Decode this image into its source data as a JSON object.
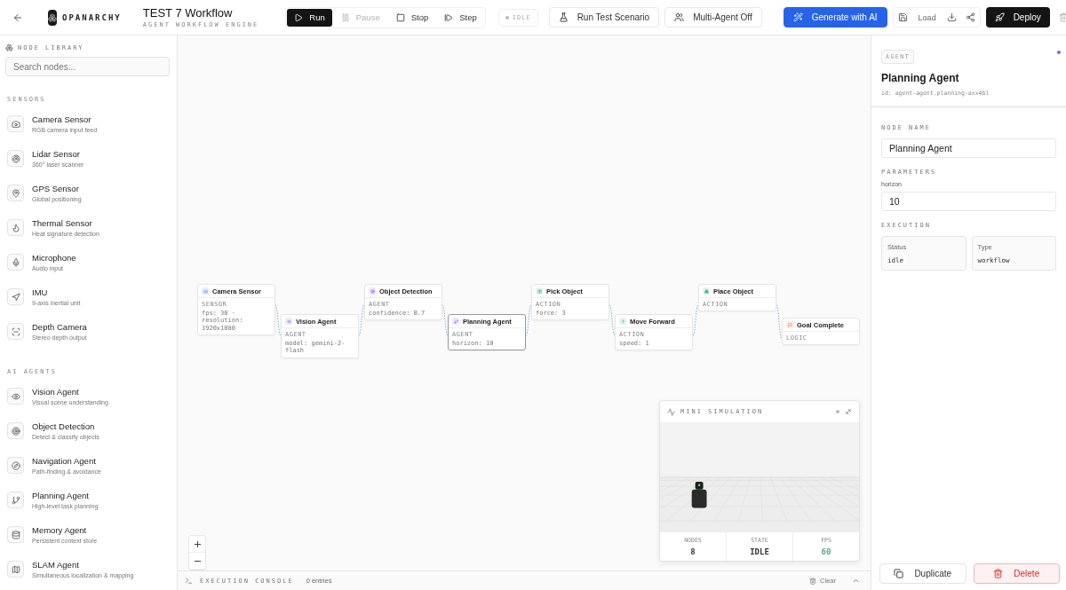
{
  "header": {
    "brand": "OPANARCHY",
    "title": "TEST 7 Workflow",
    "subtitle": "AGENT WORKFLOW ENGINE",
    "controls": [
      {
        "label": "Run",
        "kind": "primary",
        "disabled": false
      },
      {
        "label": "Pause",
        "kind": "plain",
        "disabled": true
      },
      {
        "label": "Stop",
        "kind": "plain",
        "disabled": false
      },
      {
        "label": "Step",
        "kind": "plain",
        "disabled": false
      }
    ],
    "status": "IDLE",
    "actions": [
      {
        "label": "Run Test Scenario",
        "kind": "outline"
      },
      {
        "label": "Multi-Agent Off",
        "kind": "outline"
      },
      {
        "label": "Generate with AI",
        "kind": "accent"
      }
    ],
    "load": "Load",
    "deploy": "Deploy"
  },
  "library": {
    "title": "NODE LIBRARY",
    "search_placeholder": "Search nodes...",
    "sections": [
      {
        "title": "SENSORS",
        "items": [
          {
            "name": "Camera Sensor",
            "description": "RGB camera input feed"
          },
          {
            "name": "Lidar Sensor",
            "description": "360° laser scanner"
          },
          {
            "name": "GPS Sensor",
            "description": "Global positioning"
          },
          {
            "name": "Thermal Sensor",
            "description": "Heat signature detection"
          },
          {
            "name": "Microphone",
            "description": "Audio input"
          },
          {
            "name": "IMU",
            "description": "9-axis inertial unit"
          },
          {
            "name": "Depth Camera",
            "description": "Stereo depth output"
          }
        ]
      },
      {
        "title": "AI AGENTS",
        "items": [
          {
            "name": "Vision Agent",
            "description": "Visual scene understanding"
          },
          {
            "name": "Object Detection",
            "description": "Detect & classify objects"
          },
          {
            "name": "Navigation Agent",
            "description": "Path-finding & avoidance"
          },
          {
            "name": "Planning Agent",
            "description": "High-level task planning"
          },
          {
            "name": "Memory Agent",
            "description": "Persistent context store"
          },
          {
            "name": "SLAM Agent",
            "description": "Simultaneous localization & mapping"
          }
        ]
      }
    ]
  },
  "nodes": [
    {
      "title": "Camera Sensor",
      "kind": "sensor",
      "category": "SENSOR",
      "param": "fps: 30 · resolution: 1920x1080",
      "selected": false
    },
    {
      "title": "Vision Agent",
      "kind": "agent",
      "category": "AGENT",
      "param": "model: gemini-2-flash",
      "selected": false
    },
    {
      "title": "Object Detection",
      "kind": "agent",
      "category": "AGENT",
      "param": "confidence: 0.7",
      "selected": false
    },
    {
      "title": "Planning Agent",
      "kind": "agent",
      "category": "AGENT",
      "param": "horizon: 10",
      "selected": true
    },
    {
      "title": "Pick Object",
      "kind": "action",
      "category": "ACTION",
      "param": "force: 3",
      "selected": false
    },
    {
      "title": "Move Forward",
      "kind": "action",
      "category": "ACTION",
      "param": "speed: 1",
      "selected": false
    },
    {
      "title": "Place Object",
      "kind": "action",
      "category": "ACTION",
      "selected": false
    },
    {
      "title": "Goal Complete",
      "kind": "logic",
      "category": "LOGIC",
      "selected": false
    }
  ],
  "simulation": {
    "title": "MINI SIMULATION",
    "stats": [
      {
        "label": "NODES",
        "value": "8",
        "color": "#333333"
      },
      {
        "label": "STATE",
        "value": "IDLE",
        "color": "#333333"
      },
      {
        "label": "FPS",
        "value": "60",
        "color": "#5fa592"
      }
    ]
  },
  "console": {
    "title": "EXECUTION CONSOLE",
    "count": "0 entries",
    "clear": "Clear"
  },
  "inspector": {
    "badge": "AGENT",
    "title": "Planning Agent",
    "id": "id: agent-agent.planning-axx4bl",
    "name_label": "NODE NAME",
    "name_value": "Planning Agent",
    "params_label": "PARAMETERS",
    "params": [
      {
        "name": "horizon",
        "value": "10"
      }
    ],
    "execution_label": "EXECUTION",
    "execution": [
      {
        "label": "Status",
        "value": "idle"
      },
      {
        "label": "Type",
        "value": "workflow"
      }
    ],
    "duplicate": "Duplicate",
    "delete": "Delete"
  }
}
